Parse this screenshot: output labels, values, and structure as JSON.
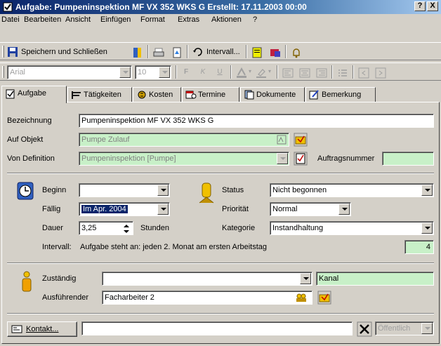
{
  "window": {
    "title": "Aufgabe: Pumpeninspektion MF VX 352 WKS G  Erstellt: 17.11.2003 00:00",
    "help_button": "?",
    "close_button": "X"
  },
  "menu": {
    "items": [
      "Datei",
      "Bearbeiten",
      "Ansicht",
      "Einfügen",
      "Format",
      "Extras",
      "Aktionen",
      "?"
    ]
  },
  "toolbar": {
    "save_close_label": "Speichern und Schließen",
    "recurrence_label": "Intervall..."
  },
  "format_toolbar": {
    "font": "Arial",
    "size": "10",
    "bold": "F",
    "italic": "K",
    "underline": "U"
  },
  "tabs": [
    {
      "label": "Aufgabe",
      "icon": "task-icon"
    },
    {
      "label": "Tätigkeiten",
      "icon": "activities-icon"
    },
    {
      "label": "Kosten",
      "icon": "costs-icon"
    },
    {
      "label": "Termine",
      "icon": "appointments-icon"
    },
    {
      "label": "Dokumente",
      "icon": "documents-icon"
    },
    {
      "label": "Bemerkung",
      "icon": "remark-icon"
    }
  ],
  "form": {
    "subject_label": "Bezeichnung",
    "subject_value": "Pumpeninspektion MF VX 352 WKS G",
    "object_label": "Auf Objekt",
    "object_value": "Pumpe Zulauf",
    "definition_label": "Von Definition",
    "definition_value": "Pumpeninspektion [Pumpe]",
    "order_number_label": "Auftragsnummer",
    "order_number_value": "",
    "start_label": "Beginn",
    "start_value": "",
    "due_label": "Fällig",
    "due_value": "Im Apr. 2004",
    "duration_label": "Dauer",
    "duration_value": "3,25",
    "duration_unit": "Stunden",
    "status_label": "Status",
    "status_value": "Nicht begonnen",
    "priority_label": "Priorität",
    "priority_value": "Normal",
    "category_label": "Kategorie",
    "category_value": "Instandhaltung",
    "interval_label": "Intervall:",
    "interval_text": "Aufgabe steht an: jeden 2. Monat am ersten Arbeitstag",
    "interval_number": "4",
    "responsible_label": "Zuständig",
    "responsible_value": "",
    "channel_value": "Kanal",
    "executor_label": "Ausführender",
    "executor_value": "Facharbeiter 2",
    "contact_button": "Kontakt...",
    "contact_value": "",
    "visibility_value": "Öffentlich"
  },
  "colors": {
    "title_start": "#0a246a",
    "title_end": "#a6caf0",
    "linked_field": "#c8f0c8",
    "window_bg": "#d4d0c8"
  }
}
